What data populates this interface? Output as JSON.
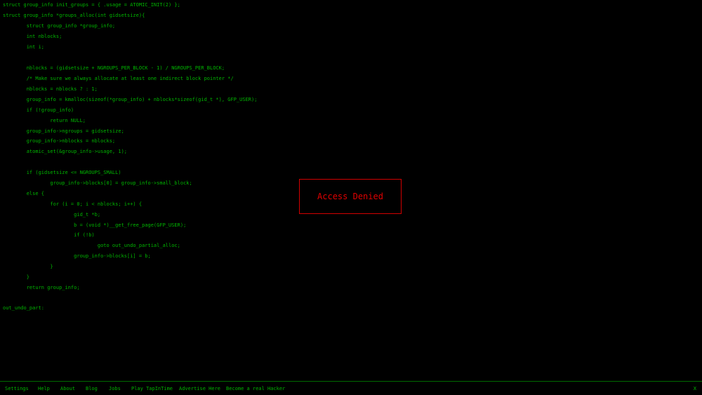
{
  "code": {
    "lines": [
      "struct group_info init_groups = { .usage = ATOMIC_INIT(2) };",
      "struct group_info *groups_alloc(int gidsetsize){",
      "        struct group_info *group_info;",
      "        int nblocks;",
      "        int i;",
      "",
      "        nblocks = (gidsetsize + NGROUPS_PER_BLOCK - 1) / NGROUPS_PER_BLOCK;",
      "        /* Make sure we always allocate at least one indirect block pointer */",
      "        nblocks = nblocks ? : 1;",
      "        group_info = kmalloc(sizeof(*group_info) + nblocks*sizeof(gid_t *), GFP_USER);",
      "        if (!group_info)",
      "                return NULL;",
      "        group_info->ngroups = gidsetsize;",
      "        group_info->nblocks = nblocks;",
      "        atomic_set(&group_info->usage, 1);",
      "",
      "        if (gidsetsize <= NGROUPS_SMALL)",
      "                group_info->blocks[0] = group_info->small_block;",
      "        else {",
      "                for (i = 0; i < nblocks; i++) {",
      "                        gid_t *b;",
      "                        b = (void *)__get_free_page(GFP_USER);",
      "                        if (!b)",
      "                                goto out_undo_partial_alloc;",
      "                        group_info->blocks[i] = b;",
      "                }",
      "        }",
      "        return group_info;",
      "",
      "out_undo_part:"
    ]
  },
  "dialog": {
    "message": "Access Denied"
  },
  "footer": {
    "links": [
      "Settings",
      "Help",
      "About",
      "Blog",
      "Jobs",
      "Play TapInTime",
      "Advertise Here",
      "Become a real Hacker"
    ],
    "close_label": "X"
  },
  "colors": {
    "background": "#000000",
    "code_text": "#00b400",
    "alert_text": "#e00000",
    "alert_border": "#d00000"
  }
}
